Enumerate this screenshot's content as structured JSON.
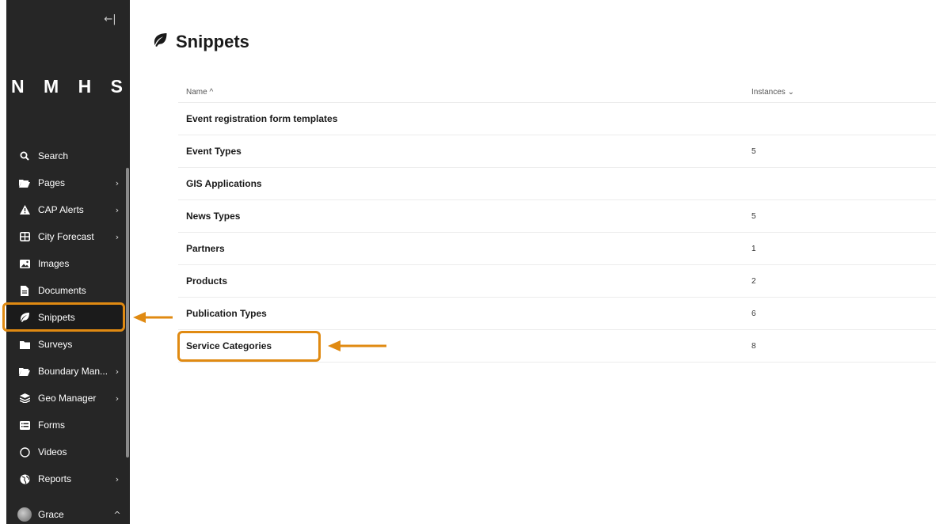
{
  "sidebar": {
    "logo": "N M H S",
    "collapse_icon": "collapse-left-icon",
    "items": [
      {
        "label": "Search",
        "icon": "search-icon",
        "chevron": ""
      },
      {
        "label": "Pages",
        "icon": "folder-open-icon",
        "chevron": "›"
      },
      {
        "label": "CAP Alerts",
        "icon": "warning-icon",
        "chevron": "›"
      },
      {
        "label": "City Forecast",
        "icon": "table-icon",
        "chevron": "›"
      },
      {
        "label": "Images",
        "icon": "image-icon",
        "chevron": ""
      },
      {
        "label": "Documents",
        "icon": "document-icon",
        "chevron": ""
      },
      {
        "label": "Snippets",
        "icon": "leaf-icon",
        "chevron": ""
      },
      {
        "label": "Surveys",
        "icon": "folder-icon",
        "chevron": ""
      },
      {
        "label": "Boundary Man...",
        "icon": "folder-open-icon",
        "chevron": "›"
      },
      {
        "label": "Geo Manager",
        "icon": "layers-icon",
        "chevron": "›"
      },
      {
        "label": "Forms",
        "icon": "list-icon",
        "chevron": ""
      },
      {
        "label": "Videos",
        "icon": "circle-icon",
        "chevron": ""
      },
      {
        "label": "Reports",
        "icon": "globe-icon",
        "chevron": "›"
      }
    ],
    "user": {
      "name": "Grace",
      "chevron": "^"
    }
  },
  "page": {
    "title": "Snippets",
    "title_icon": "leaf-icon"
  },
  "table": {
    "col_name": "Name ^",
    "col_instances": "Instances ⌄",
    "rows": [
      {
        "name": "Event registration form templates",
        "count": ""
      },
      {
        "name": "Event Types",
        "count": "5"
      },
      {
        "name": "GIS Applications",
        "count": ""
      },
      {
        "name": "News Types",
        "count": "5"
      },
      {
        "name": "Partners",
        "count": "1"
      },
      {
        "name": "Products",
        "count": "2"
      },
      {
        "name": "Publication Types",
        "count": "6"
      },
      {
        "name": "Service Categories",
        "count": "8"
      }
    ]
  },
  "colors": {
    "sidebar_bg": "#262626",
    "highlight": "#e08a12"
  }
}
